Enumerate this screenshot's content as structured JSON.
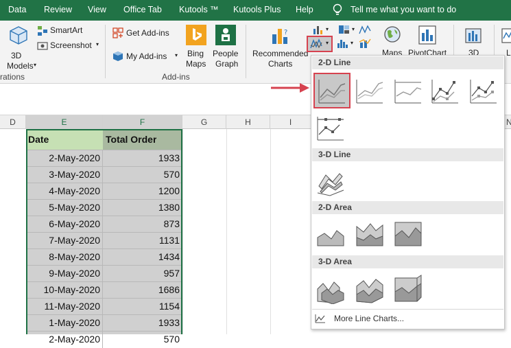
{
  "menubar": {
    "items": [
      "Data",
      "Review",
      "View",
      "Office Tab",
      "Kutools ™",
      "Kutools Plus",
      "Help"
    ],
    "tell_me": "Tell me what you want to do"
  },
  "ribbon": {
    "models_label": "3D",
    "models_label2": "Models",
    "smartart": "SmartArt",
    "screenshot": "Screenshot",
    "group_illustrations": "rations",
    "get_addins": "Get Add-ins",
    "my_addins": "My Add-ins",
    "bing1": "Bing",
    "bing2": "Maps",
    "people1": "People",
    "people2": "Graph",
    "group_addins": "Add-ins",
    "recommended1": "Recommended",
    "recommended2": "Charts",
    "maps": "Maps",
    "pivotchart": "PivotChart",
    "threeD": "3D",
    "cut_l": "L"
  },
  "columns": [
    "D",
    "E",
    "F",
    "G",
    "H",
    "I",
    "N"
  ],
  "table": {
    "headers": [
      "Date",
      "Total Order"
    ],
    "rows": [
      [
        "2-May-2020",
        "1933"
      ],
      [
        "3-May-2020",
        "570"
      ],
      [
        "4-May-2020",
        "1200"
      ],
      [
        "5-May-2020",
        "1380"
      ],
      [
        "6-May-2020",
        "873"
      ],
      [
        "7-May-2020",
        "1131"
      ],
      [
        "8-May-2020",
        "1434"
      ],
      [
        "9-May-2020",
        "957"
      ],
      [
        "10-May-2020",
        "1686"
      ],
      [
        "11-May-2020",
        "1154"
      ],
      [
        "1-May-2020",
        "1933"
      ],
      [
        "2-May-2020",
        "570"
      ]
    ]
  },
  "dropdown": {
    "sections": [
      "2-D Line",
      "3-D Line",
      "2-D Area",
      "3-D Area"
    ],
    "more": "More Line Charts..."
  },
  "colors": {
    "excel_green": "#217346",
    "highlight": "#d6424f",
    "selection_border": "#1e7145"
  }
}
